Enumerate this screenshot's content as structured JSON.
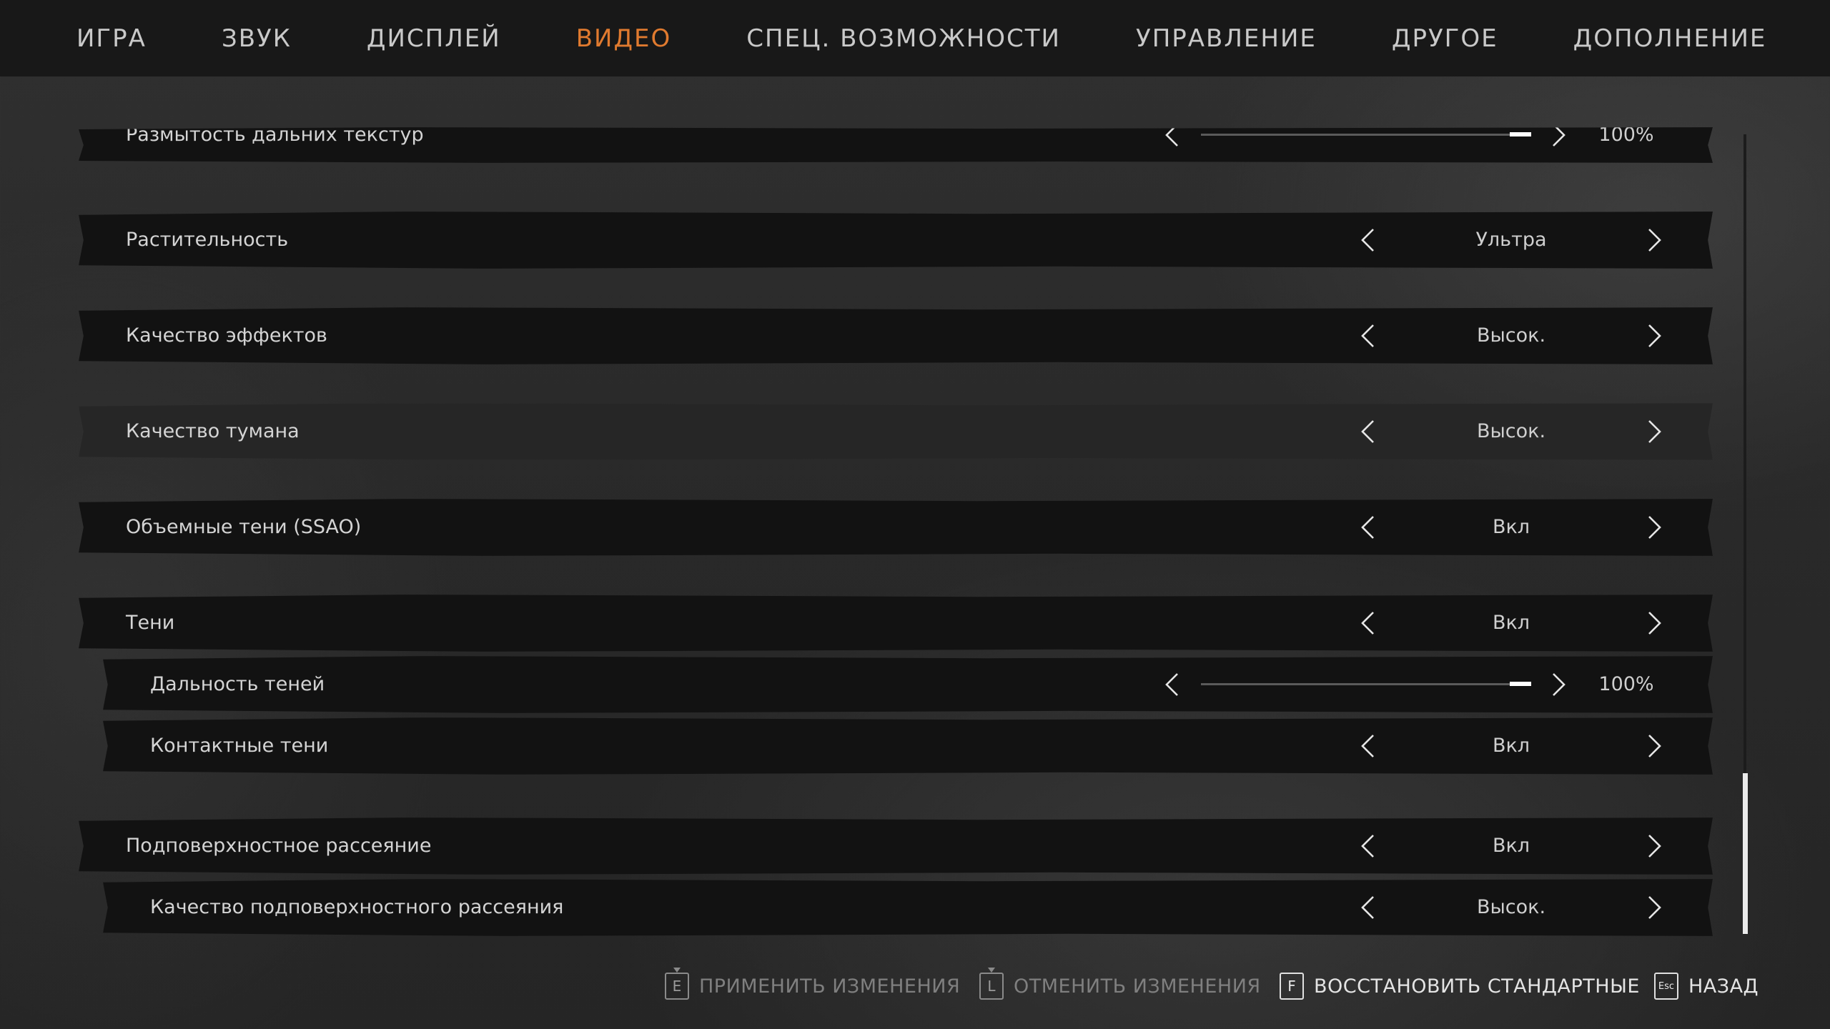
{
  "tabs": [
    {
      "label": "ИГРА",
      "active": false
    },
    {
      "label": "ЗВУК",
      "active": false
    },
    {
      "label": "ДИСПЛЕЙ",
      "active": false
    },
    {
      "label": "ВИДЕО",
      "active": true
    },
    {
      "label": "СПЕЦ. ВОЗМОЖНОСТИ",
      "active": false
    },
    {
      "label": "УПРАВЛЕНИЕ",
      "active": false
    },
    {
      "label": "ДРУГОЕ",
      "active": false
    },
    {
      "label": "ДОПОЛНЕНИЕ",
      "active": false
    }
  ],
  "colors": {
    "accent": "#e07a2f",
    "row_background": "#121212",
    "row_highlight": "#262626"
  },
  "settings": [
    {
      "label": "Размытость дальних текстур",
      "type": "slider",
      "value": "100%",
      "level": 1.0,
      "sub": false,
      "highlight": false
    },
    {
      "label": "Растительность",
      "type": "select",
      "value": "Ультра",
      "sub": false,
      "highlight": false
    },
    {
      "label": "Качество эффектов",
      "type": "select",
      "value": "Высок.",
      "sub": false,
      "highlight": false
    },
    {
      "label": "Качество тумана",
      "type": "select",
      "value": "Высок.",
      "sub": false,
      "highlight": true
    },
    {
      "label": "Объемные тени (SSAO)",
      "type": "select",
      "value": "Вкл",
      "sub": false,
      "highlight": false
    },
    {
      "label": "Тени",
      "type": "select",
      "value": "Вкл",
      "sub": false,
      "highlight": false
    },
    {
      "label": "Дальность теней",
      "type": "slider",
      "value": "100%",
      "level": 1.0,
      "sub": true,
      "highlight": false
    },
    {
      "label": "Контактные тени",
      "type": "select",
      "value": "Вкл",
      "sub": true,
      "highlight": false
    },
    {
      "label": "Подповерхностное рассеяние",
      "type": "select",
      "value": "Вкл",
      "sub": false,
      "highlight": false
    },
    {
      "label": "Качество подповерхностного рассеяния",
      "type": "select",
      "value": "Высок.",
      "sub": true,
      "highlight": false
    }
  ],
  "footer": {
    "apply": {
      "key": "E",
      "label": "ПРИМЕНИТЬ ИЗМЕНЕНИЯ"
    },
    "cancel": {
      "key": "L",
      "label": "ОТМЕНИТЬ ИЗМЕНЕНИЯ"
    },
    "restore": {
      "key": "F",
      "label": "ВОССТАНОВИТЬ СТАНДАРТНЫЕ"
    },
    "back": {
      "key": "Esc",
      "label": "НАЗАД"
    }
  },
  "icons": {
    "left_arrow": "chevron-left-icon",
    "right_arrow": "chevron-right-icon"
  }
}
